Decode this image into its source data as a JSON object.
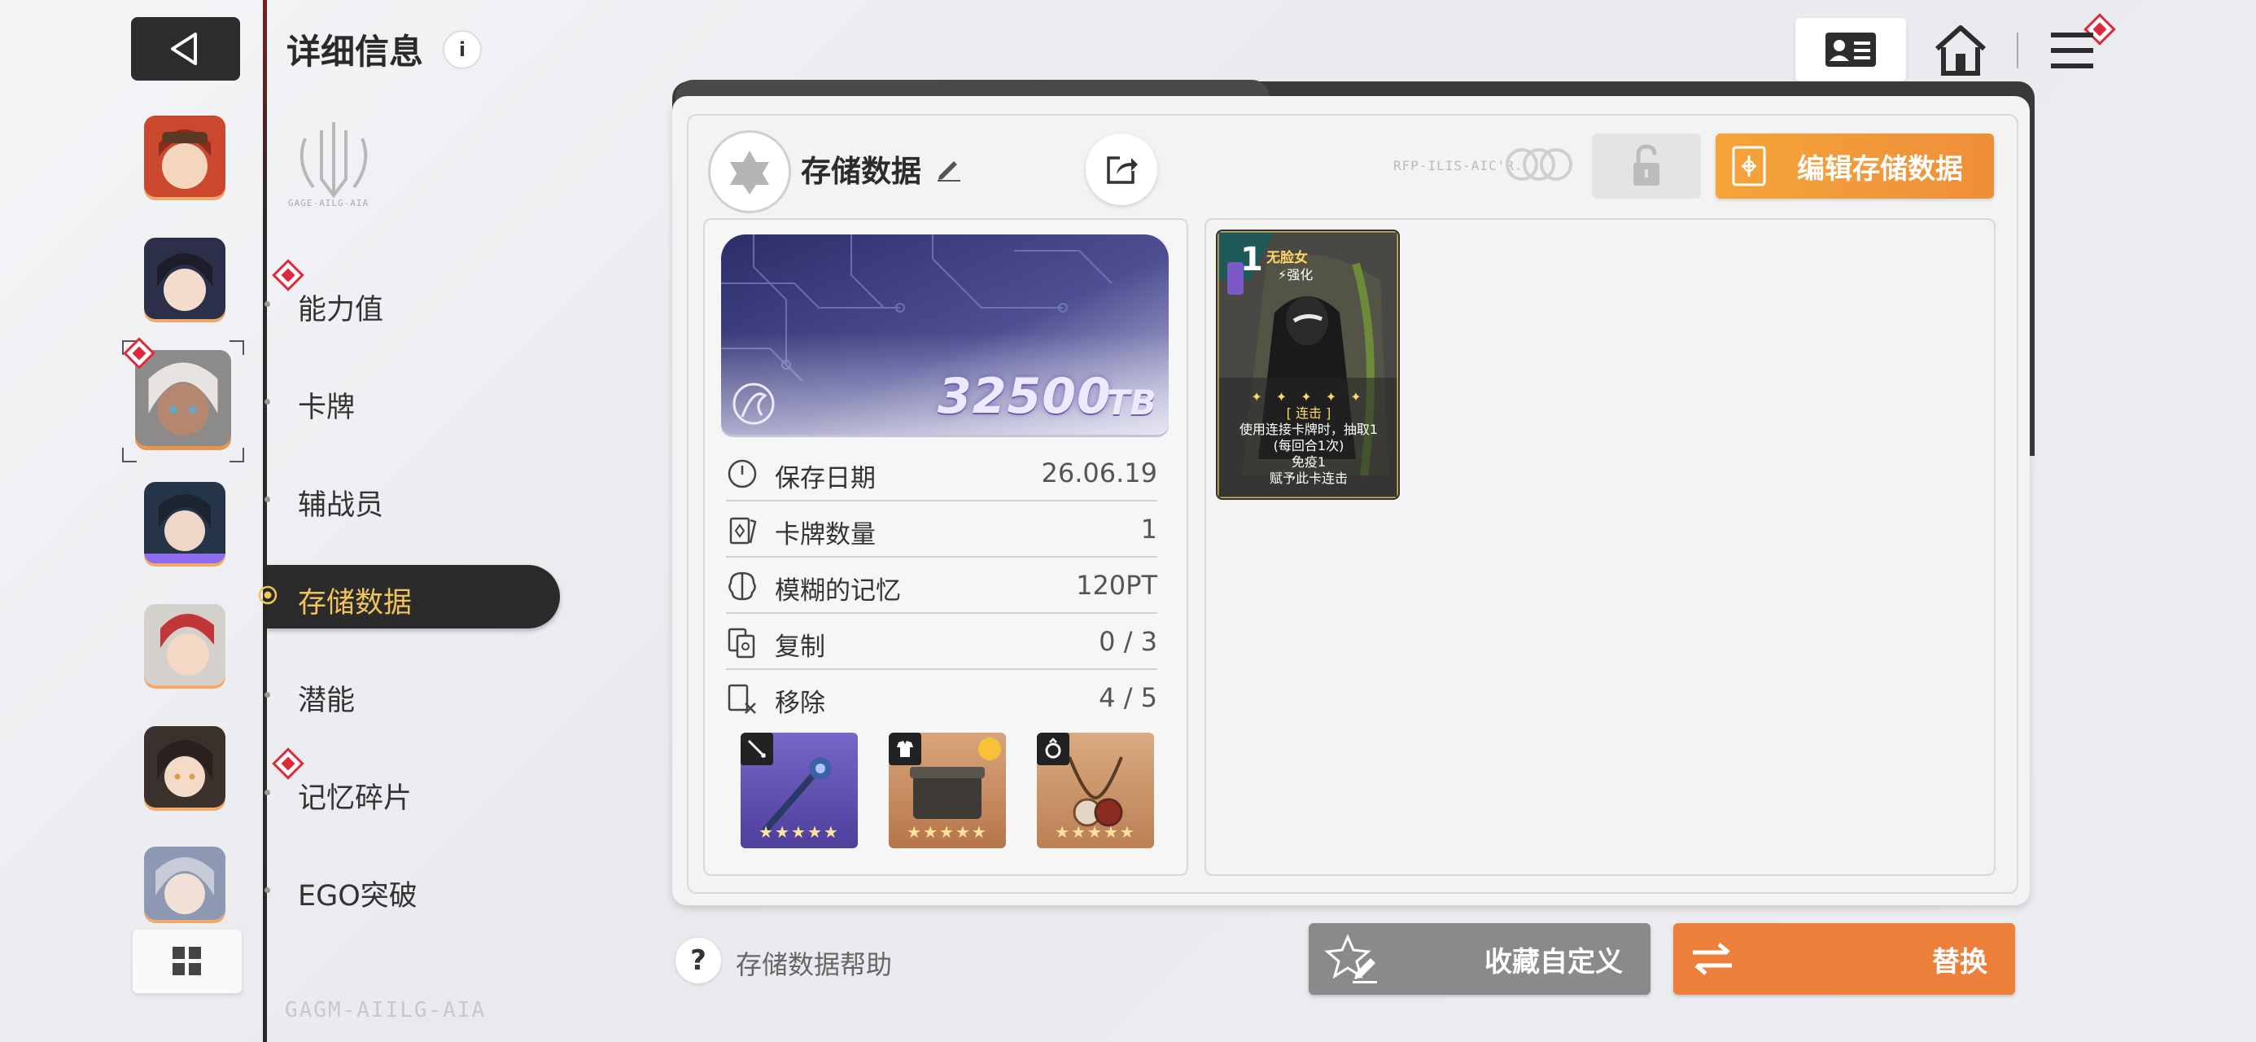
{
  "header": {
    "title": "详细信息",
    "info": "i"
  },
  "nav": {
    "items": [
      {
        "label": "能力值"
      },
      {
        "label": "卡牌"
      },
      {
        "label": "辅战员"
      },
      {
        "label": "存储数据"
      },
      {
        "label": "潜能"
      },
      {
        "label": "记忆碎片"
      },
      {
        "label": "EGO突破"
      }
    ],
    "active": "存储数据"
  },
  "panel": {
    "title": "存储数据",
    "edit_button": "编辑存储数据",
    "banner": {
      "value": "32500",
      "unit": "TB"
    },
    "stats": [
      {
        "label": "保存日期",
        "value": "26.06.19"
      },
      {
        "label": "卡牌数量",
        "value": "1"
      },
      {
        "label": "模糊的记忆",
        "value": "120PT"
      },
      {
        "label": "复制",
        "value": "0 / 3"
      },
      {
        "label": "移除",
        "value": "4 / 5"
      }
    ],
    "equipment": [
      {
        "slot": "weapon",
        "stars": "★★★★★"
      },
      {
        "slot": "armor",
        "stars": "★★★★★"
      },
      {
        "slot": "accessory",
        "stars": "★★★★★"
      }
    ],
    "card": {
      "cost": "1",
      "name": "无脸女",
      "tag": "⚡强化",
      "keyword": "[ 连击 ]",
      "line1": "使用连接卡牌时，抽取1",
      "line2": "(每回合1次)",
      "line3": "免疫1",
      "line4": "赋予此卡连击"
    }
  },
  "footer": {
    "help": "存储数据帮助",
    "collect": "收藏自定义",
    "replace": "替换"
  },
  "colors": {
    "accent_orange": "#ec7f3a",
    "active_gold": "#f1c45a",
    "alert_red": "#e0283a",
    "dark": "#2b2b2b"
  }
}
